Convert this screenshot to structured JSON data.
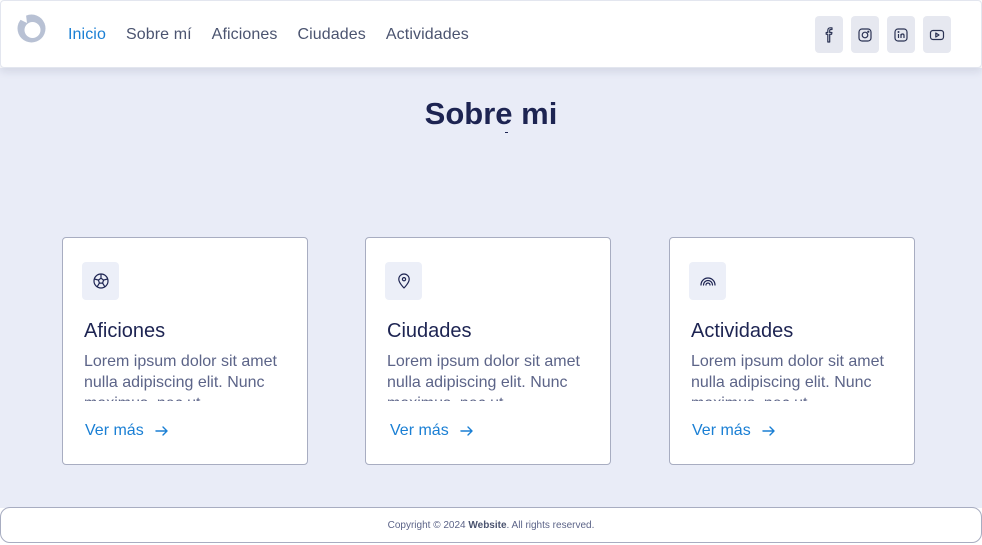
{
  "nav": {
    "links": [
      {
        "label": "Inicio",
        "active": true
      },
      {
        "label": "Sobre mí"
      },
      {
        "label": "Aficiones"
      },
      {
        "label": "Ciudades"
      },
      {
        "label": "Actividades"
      }
    ],
    "socials": [
      "facebook-icon",
      "instagram-icon",
      "linkedin-icon",
      "youtube-icon"
    ]
  },
  "main": {
    "title": "Sobre mi",
    "cards": [
      {
        "icon": "soccer-ball-icon",
        "title": "Aficiones",
        "text": "Lorem ipsum dolor sit amet nulla adipiscing elit. Nunc maximus, nec ut",
        "link": "Ver más"
      },
      {
        "icon": "location-pin-icon",
        "title": "Ciudades",
        "text": "Lorem ipsum dolor sit amet nulla adipiscing elit. Nunc maximus, nec ut",
        "link": "Ver más"
      },
      {
        "icon": "rainbow-icon",
        "title": "Actividades",
        "text": "Lorem ipsum dolor sit amet nulla adipiscing elit. Nunc maximus, nec ut",
        "link": "Ver más"
      }
    ]
  },
  "footer": {
    "prefix": "Copyright © 2024 ",
    "brand": "Website",
    "suffix": ". All rights reserved."
  },
  "colors": {
    "accent": "#1a7fd4",
    "heading": "#1d2452",
    "background": "#e9ecf7"
  }
}
